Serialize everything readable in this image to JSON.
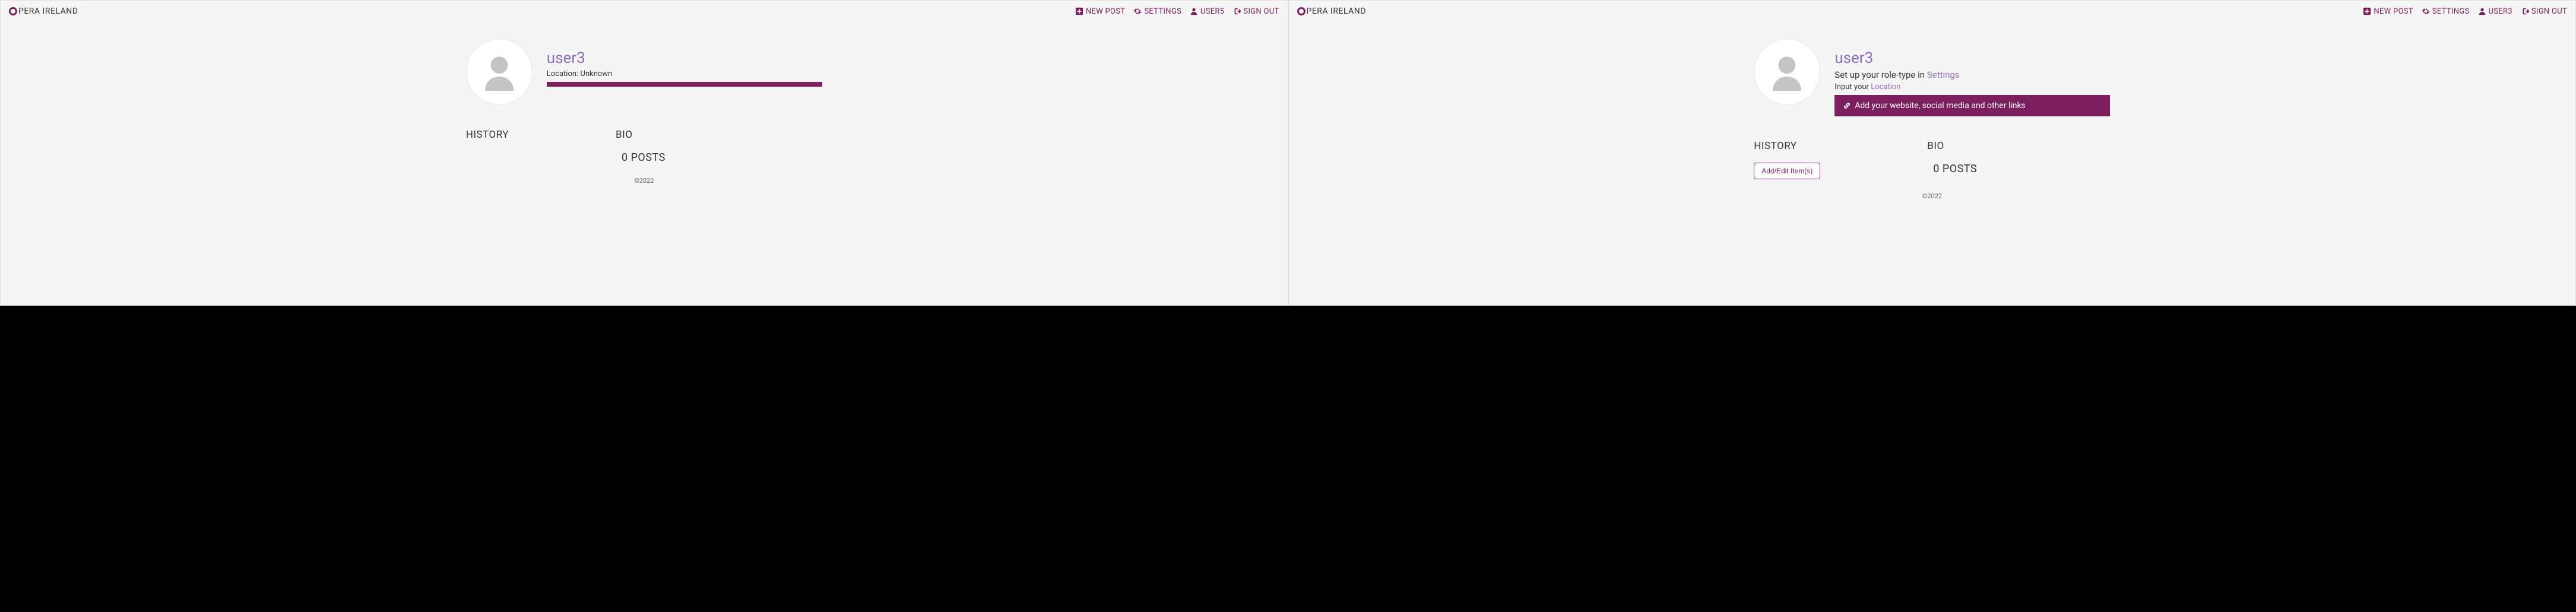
{
  "left": {
    "brand": "PERA IRELAND",
    "nav": {
      "new_post": "NEW POST",
      "settings": "SETTINGS",
      "user": "USER5",
      "sign_out": "SIGN OUT"
    },
    "profile": {
      "username": "user3",
      "location_label": "Location: Unknown"
    },
    "sections": {
      "history": "HISTORY",
      "bio": "BIO",
      "posts": "0 POSTS"
    },
    "footer": "©2022"
  },
  "right": {
    "brand": "PERA IRELAND",
    "nav": {
      "new_post": "NEW POST",
      "settings": "SETTINGS",
      "user": "USER3",
      "sign_out": "SIGN OUT"
    },
    "profile": {
      "username": "user3",
      "role_prefix": "Set up your role-type in ",
      "role_link": "Settings",
      "location_prefix": "Input your ",
      "location_link": "Location",
      "links_bar": "Add your website, social media and other links"
    },
    "sections": {
      "history": "HISTORY",
      "bio": "BIO",
      "posts": "0 POSTS",
      "addedit": "Add/Edit Item(s)"
    },
    "footer": "©2022"
  }
}
